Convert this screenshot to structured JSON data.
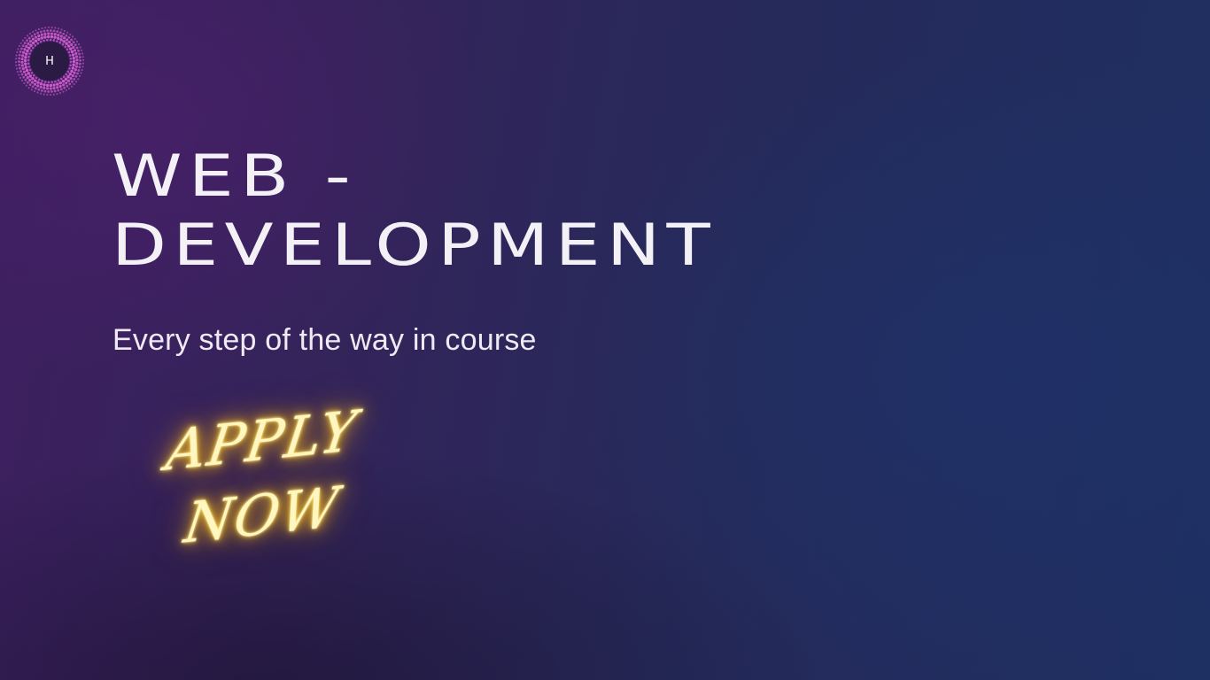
{
  "brand": {
    "logo_letter": "H",
    "logo_color": "#d35fd0"
  },
  "hero": {
    "title_line1": "WEB -",
    "title_line2": "DEVELOPMENT",
    "subtitle": "Every step of the way in course"
  },
  "cta": {
    "line1": "APPLY",
    "line2": "NOW",
    "glow_color": "#ffd84a"
  },
  "colors": {
    "background_left": "#3e1f60",
    "background_right": "#1e2f62",
    "text": "#f3f0f6"
  }
}
